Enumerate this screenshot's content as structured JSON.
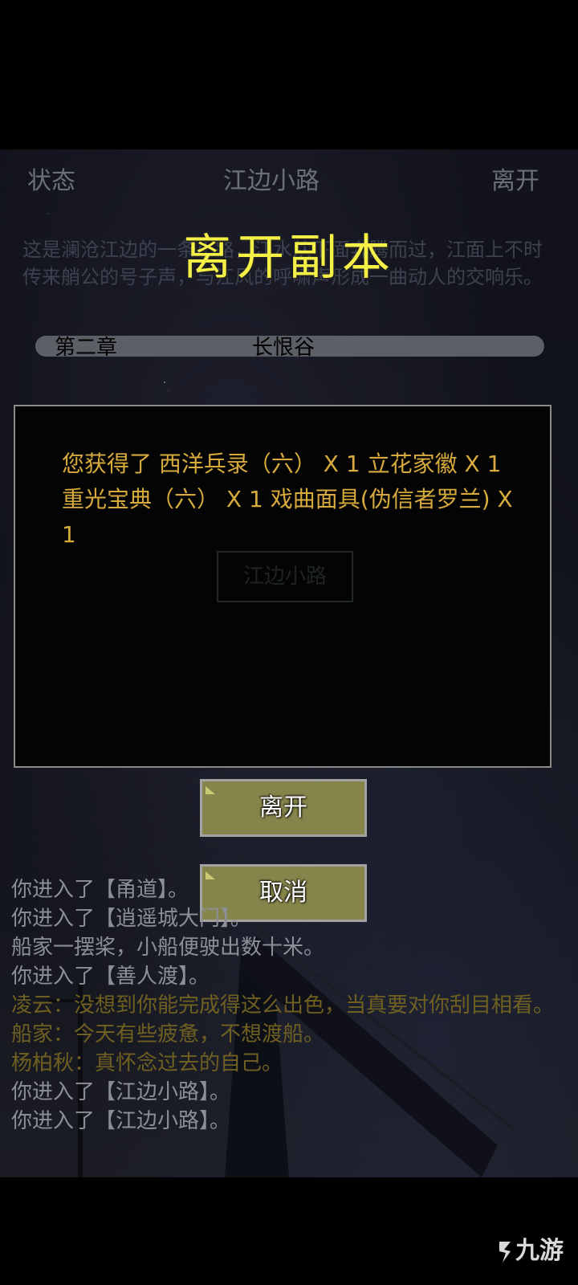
{
  "topbar": {
    "left": "状态",
    "center": "江边小路",
    "right": "离开"
  },
  "scene": {
    "description": "这是澜沧江边的一条小路，江水从下面奔腾而过，江面上不时传来艄公的号子声，与江风的呼啸声形成一曲动人的交响乐。",
    "chapter_label": "第二章",
    "chapter_name": "长恨谷",
    "ghost_button": "江边小路"
  },
  "dialog": {
    "title": "离开副本",
    "message": "您获得了 西洋兵录（六） X 1 立花家徽 X 1 重光宝典（六） X 1 戏曲面具(伪信者罗兰) X 1",
    "confirm_label": "离开",
    "cancel_label": "取消"
  },
  "log": [
    {
      "text": "你进入了【甬道】。",
      "color": "white"
    },
    {
      "text": "你进入了【逍遥城大门】。",
      "color": "white"
    },
    {
      "text": "船家一摆桨，小船便驶出数十米。",
      "color": "white"
    },
    {
      "text": "你进入了【善人渡】。",
      "color": "white"
    },
    {
      "text": "凌云：没想到你能完成得这么出色，当真要对你刮目相看。",
      "color": "yellow"
    },
    {
      "text": "船家：今天有些疲惫，不想渡船。",
      "color": "yellow"
    },
    {
      "text": "杨柏秋：真怀念过去的自己。",
      "color": "yellow"
    },
    {
      "text": "你进入了【江边小路】。",
      "color": "white"
    },
    {
      "text": "你进入了【江边小路】。",
      "color": "white"
    }
  ],
  "watermark": {
    "text": "九游"
  }
}
